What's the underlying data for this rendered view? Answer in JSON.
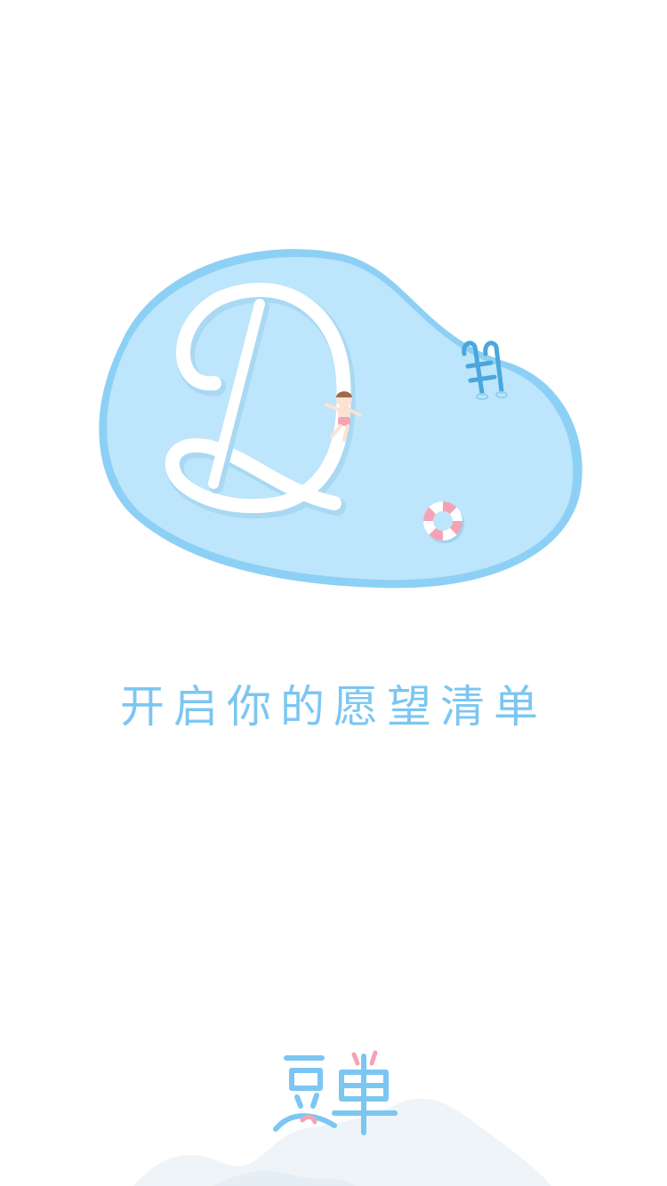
{
  "splash": {
    "slogan": "开启你的愿望清单",
    "logo_text": "豆单",
    "illustration": {
      "pool_icon": "pool-letter-d-icon",
      "swimmer_icon": "swimmer-icon",
      "ladder_icon": "pool-ladder-icon",
      "ring_icon": "lifebuoy-icon"
    }
  },
  "colors": {
    "pool_fill": "#bde5fb",
    "pool_edge": "#8dd0f5",
    "accent_blue": "#7cc6f2",
    "logo_pink": "#f4a3b4",
    "hill_fill": "#eef4f8",
    "background": "#ffffff"
  }
}
